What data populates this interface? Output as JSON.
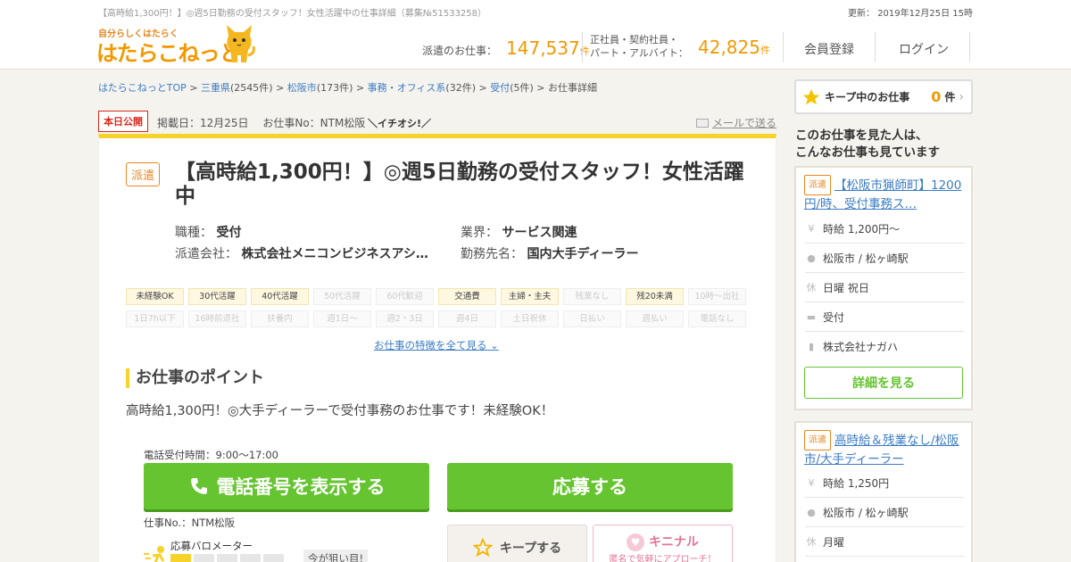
{
  "header": {
    "page_title": "【高時給1,300円！】◎週5日勤務の受付スタッフ！女性活躍中の仕事詳細（募集№51533258）",
    "updated": "更新： 2019年12月25日 15時",
    "logo_tagline": "自分らしくはたらく",
    "logo_text": "はたらこねっと",
    "stat_haken_label": "派遣のお仕事：",
    "stat_haken_value": "147,537",
    "stat_unit": "件",
    "stat_other_label_1": "正社員・契約社員・",
    "stat_other_label_2": "パート・アルバイト：",
    "stat_other_value": "42,825",
    "register": "会員登録",
    "login": "ログイン"
  },
  "breadcrumb": [
    {
      "label": "はたらこねっとTOP",
      "count": ""
    },
    {
      "label": "三重県",
      "count": "(2545件)"
    },
    {
      "label": "松阪市",
      "count": "(173件)"
    },
    {
      "label": "事務・オフィス系",
      "count": "(32件)"
    },
    {
      "label": "受付",
      "count": "(5件)"
    },
    {
      "label": "お仕事詳細",
      "count": ""
    }
  ],
  "meta": {
    "today_badge": "本日公開",
    "posted": "掲載日：12月25日　 お仕事No：NTM松阪",
    "ichioshi": "＼イチオシ!／",
    "mail": "メールで送る"
  },
  "job": {
    "type": "派遣",
    "title": "【高時給1,300円！】◎週5日勤務の受付スタッフ！女性活躍中",
    "shokushu_label": "職種：",
    "shokushu": "受付",
    "gyokai_label": "業界：",
    "gyokai": "サービス関連",
    "company_label": "派遣会社：",
    "company": "株式会社メニコンビジネスアシ…",
    "workplace_label": "勤務先名：",
    "workplace": "国内大手ディーラー",
    "tags": [
      {
        "label": "未経験OK",
        "on": true
      },
      {
        "label": "30代活躍",
        "on": true
      },
      {
        "label": "40代活躍",
        "on": true
      },
      {
        "label": "50代活躍",
        "on": false
      },
      {
        "label": "60代歓迎",
        "on": false
      },
      {
        "label": "交通費",
        "on": true
      },
      {
        "label": "主婦・主夫",
        "on": true
      },
      {
        "label": "残業なし",
        "on": false
      },
      {
        "label": "残20未満",
        "on": true
      },
      {
        "label": "10時～出社",
        "on": false
      },
      {
        "label": "1日7h以下",
        "on": false
      },
      {
        "label": "16時前退社",
        "on": false
      },
      {
        "label": "扶養内",
        "on": false
      },
      {
        "label": "週1日～",
        "on": false
      },
      {
        "label": "週2・3日",
        "on": false
      },
      {
        "label": "週4日",
        "on": false
      },
      {
        "label": "土日祝休",
        "on": false
      },
      {
        "label": "日払い",
        "on": false
      },
      {
        "label": "週払い",
        "on": false
      },
      {
        "label": "電話なし",
        "on": false
      }
    ],
    "more_features": "お仕事の特徴を全て見る",
    "point_heading": "お仕事のポイント",
    "point_text": "高時給1,300円！◎大手ディーラーで受付事務のお仕事です！未経験OK！",
    "tel_time": "電話受付時間：9:00～17:00",
    "tel_button": "電話番号を表示する",
    "apply_button": "応募する",
    "job_no": "仕事No.：NTM松阪",
    "barometer_label": "応募バロメーター",
    "barometer_level": 1,
    "barometer_max": 5,
    "barometer_now": "今が狙い目!",
    "keep_button": "キープする",
    "kininaru": "キニナル",
    "kininaru_sub": "匿名で気軽にアプローチ！"
  },
  "sidebar": {
    "keep_label": "キープ中のお仕事",
    "keep_count": "0",
    "keep_unit": "件",
    "also_viewed_1": "このお仕事を見た人は、",
    "also_viewed_2": "こんなお仕事も見ています",
    "cards": [
      {
        "type": "派遣",
        "title": "【松阪市猟師町】1200円/時、受付事務ス…",
        "wage": "時給 1,200円～",
        "station": "松阪市 / 松ヶ崎駅",
        "holiday": "日曜 祝日",
        "job": "受付",
        "company": "株式会社ナガハ",
        "detail": "詳細を見る"
      },
      {
        "type": "派遣",
        "title": "高時給＆残業なし/松阪市/大手ディーラー",
        "wage": "時給 1,250円",
        "station": "松阪市 / 松ヶ崎駅",
        "holiday": "月曜"
      }
    ]
  },
  "colors": {
    "accent": "#f39800",
    "green": "#65c42f",
    "yellow": "#f5d32a",
    "link": "#3b7cc4"
  }
}
